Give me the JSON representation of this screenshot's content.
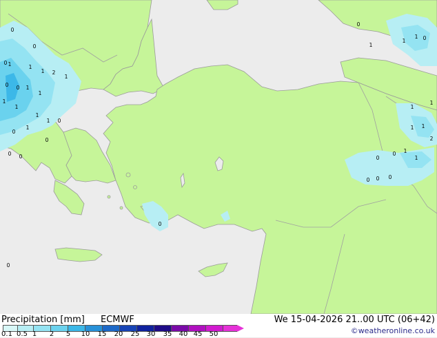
{
  "footer": {
    "title": "Precipitation [mm]",
    "model": "ECMWF",
    "datetime": "We 15-04-2026 21..00 UTC (06+42)",
    "credit": "©weatheronline.co.uk"
  },
  "legend": {
    "tick_labels": [
      "0.1",
      "0.5",
      "1",
      "2",
      "5",
      "10",
      "15",
      "20",
      "25",
      "30",
      "35",
      "40",
      "45",
      "50"
    ],
    "colors": [
      "#d8f7f7",
      "#b7eef4",
      "#94e3f2",
      "#6ad2ee",
      "#3cb8e8",
      "#2891d8",
      "#1d69c8",
      "#1744b6",
      "#10229e",
      "#1f0c88",
      "#7a0aa8",
      "#b010c0",
      "#d21ad0",
      "#e632d8"
    ]
  },
  "map": {
    "land_color": "#c6f599",
    "sea_color": "#ececec",
    "border_color": "#a0a0a0",
    "point_labels": [
      "1",
      "1",
      "1",
      "2",
      "1",
      "1",
      "1",
      "0",
      "1",
      "1",
      "1",
      "1",
      "1",
      "0",
      "0",
      "1",
      "1",
      "0",
      "0",
      "1",
      "1",
      "1",
      "1",
      "1",
      "2",
      "1",
      "1",
      "0",
      "0",
      "0",
      "0",
      "0",
      "0",
      "0",
      "0",
      "0",
      "0",
      "0",
      "0",
      "0",
      "0"
    ]
  }
}
